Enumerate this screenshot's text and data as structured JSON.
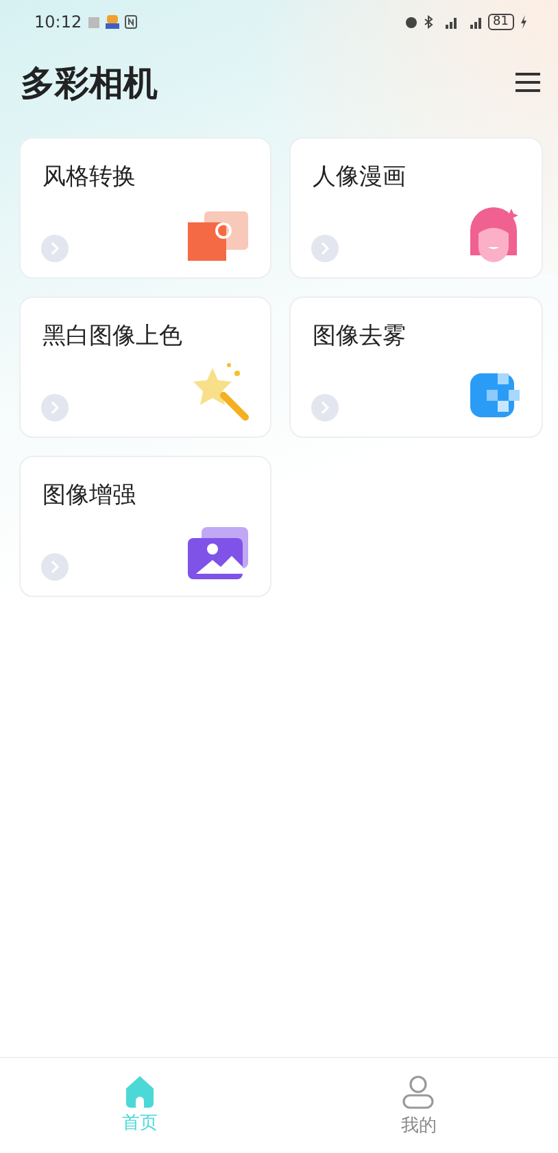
{
  "status_bar": {
    "time": "10:12",
    "battery": "81"
  },
  "header": {
    "title": "多彩相机"
  },
  "features": [
    {
      "label": "风格转换",
      "kind": "camera"
    },
    {
      "label": "人像漫画",
      "kind": "portrait"
    },
    {
      "label": "黑白图像上色",
      "kind": "wand"
    },
    {
      "label": "图像去雾",
      "kind": "dehaze"
    },
    {
      "label": "图像增强",
      "kind": "image"
    }
  ],
  "tabs": [
    {
      "label": "首页",
      "kind": "home",
      "selected": true
    },
    {
      "label": "我的",
      "kind": "profile",
      "selected": false
    }
  ]
}
